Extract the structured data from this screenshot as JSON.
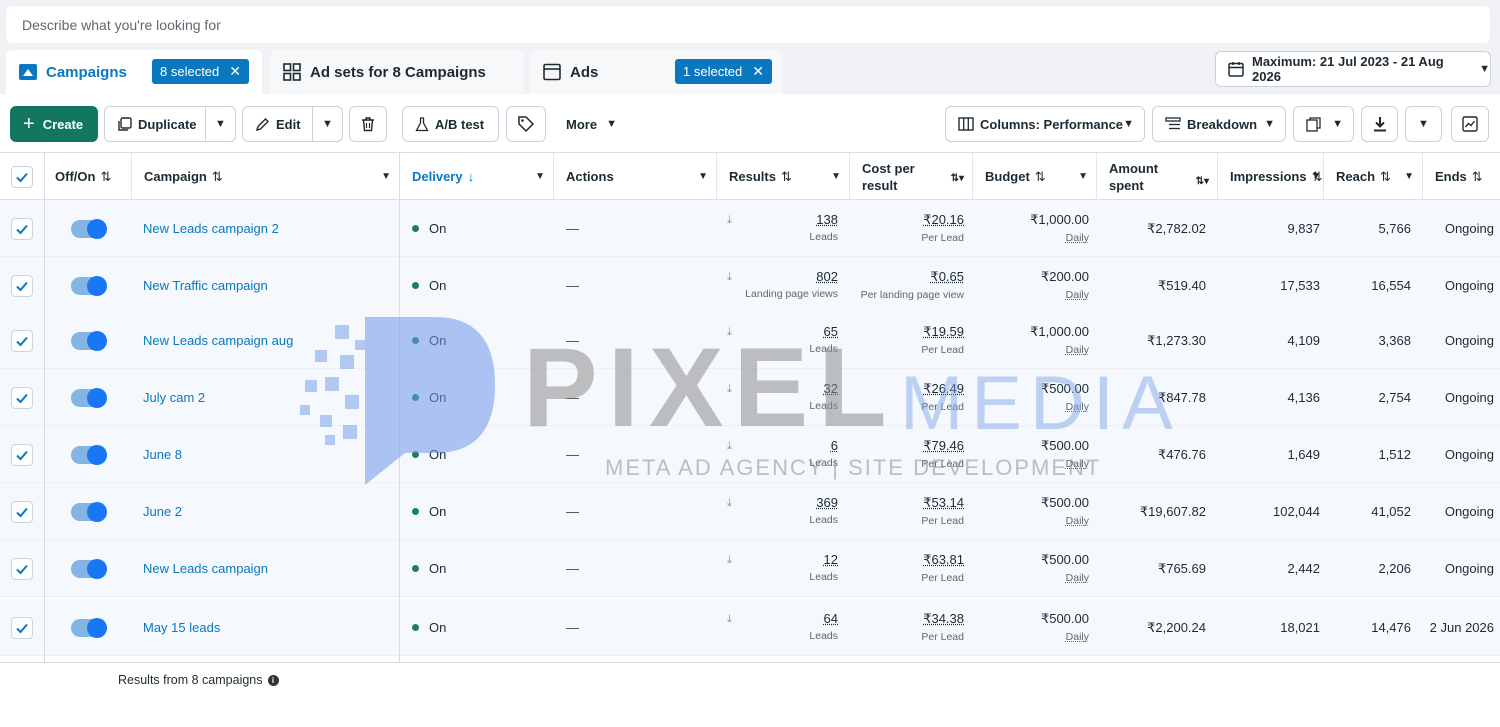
{
  "search": {
    "placeholder": "Describe what you're looking for"
  },
  "tabs": {
    "campaigns": {
      "label": "Campaigns",
      "badge": "8 selected"
    },
    "adsets": {
      "label": "Ad sets for 8 Campaigns"
    },
    "ads": {
      "label": "Ads",
      "badge": "1 selected"
    }
  },
  "date_range": "Maximum: 21 Jul 2023 - 21 Aug 2026",
  "toolbar": {
    "create": "Create",
    "duplicate": "Duplicate",
    "edit": "Edit",
    "ab_test": "A/B test",
    "more": "More",
    "columns": "Columns: Performance",
    "breakdown": "Breakdown"
  },
  "columns": {
    "offon": "Off/On",
    "campaign": "Campaign",
    "delivery": "Delivery",
    "actions": "Actions",
    "results": "Results",
    "cost_line1": "Cost per",
    "cost_line2": "result",
    "budget": "Budget",
    "amount_line1": "Amount",
    "amount_line2": "spent",
    "impressions": "Impressions",
    "reach": "Reach",
    "ends": "Ends"
  },
  "rows": [
    {
      "name": "New Leads campaign 2",
      "delivery": "On",
      "actions": "—",
      "results": "138",
      "results_sub": "Leads",
      "cost": "₹20.16",
      "cost_sub": "Per Lead",
      "budget": "₹1,000.00",
      "budget_sub": "Daily",
      "spent": "₹2,782.02",
      "impressions": "9,837",
      "reach": "5,766",
      "ends": "Ongoing"
    },
    {
      "name": "New Traffic campaign",
      "delivery": "On",
      "actions": "—",
      "results": "802",
      "results_sub": "Landing page views",
      "cost": "₹0.65",
      "cost_sub": "Per landing page view",
      "budget": "₹200.00",
      "budget_sub": "Daily",
      "spent": "₹519.40",
      "impressions": "17,533",
      "reach": "16,554",
      "ends": "Ongoing"
    },
    {
      "name": "New Leads campaign aug",
      "delivery": "On",
      "actions": "—",
      "results": "65",
      "results_sub": "Leads",
      "cost": "₹19.59",
      "cost_sub": "Per Lead",
      "budget": "₹1,000.00",
      "budget_sub": "Daily",
      "spent": "₹1,273.30",
      "impressions": "4,109",
      "reach": "3,368",
      "ends": "Ongoing"
    },
    {
      "name": "July cam 2",
      "delivery": "On",
      "actions": "—",
      "results": "32",
      "results_sub": "Leads",
      "cost": "₹26.49",
      "cost_sub": "Per Lead",
      "budget": "₹500.00",
      "budget_sub": "Daily",
      "spent": "₹847.78",
      "impressions": "4,136",
      "reach": "2,754",
      "ends": "Ongoing"
    },
    {
      "name": "June 8",
      "delivery": "On",
      "actions": "—",
      "results": "6",
      "results_sub": "Leads",
      "cost": "₹79.46",
      "cost_sub": "Per Lead",
      "budget": "₹500.00",
      "budget_sub": "Daily",
      "spent": "₹476.76",
      "impressions": "1,649",
      "reach": "1,512",
      "ends": "Ongoing"
    },
    {
      "name": "June 2",
      "delivery": "On",
      "actions": "—",
      "results": "369",
      "results_sub": "Leads",
      "cost": "₹53.14",
      "cost_sub": "Per Lead",
      "budget": "₹500.00",
      "budget_sub": "Daily",
      "spent": "₹19,607.82",
      "impressions": "102,044",
      "reach": "41,052",
      "ends": "Ongoing"
    },
    {
      "name": "New Leads campaign",
      "delivery": "On",
      "actions": "—",
      "results": "12",
      "results_sub": "Leads",
      "cost": "₹63.81",
      "cost_sub": "Per Lead",
      "budget": "₹500.00",
      "budget_sub": "Daily",
      "spent": "₹765.69",
      "impressions": "2,442",
      "reach": "2,206",
      "ends": "Ongoing"
    },
    {
      "name": "May 15 leads",
      "delivery": "On",
      "actions": "—",
      "results": "64",
      "results_sub": "Leads",
      "cost": "₹34.38",
      "cost_sub": "Per Lead",
      "budget": "₹500.00",
      "budget_sub": "Daily",
      "spent": "₹2,200.24",
      "impressions": "18,021",
      "reach": "14,476",
      "ends": "2 Jun 2026"
    }
  ],
  "footer": {
    "text": "Results from 8 campaigns"
  },
  "watermark": {
    "brand": "PIXEL",
    "brand2": "MEDIA",
    "tagline": "META AD AGENCY  |  SITE DEVELOPMENT"
  },
  "colors": {
    "accent": "#0a78be",
    "create": "#13765f",
    "toggle": "#1877f2",
    "status_on": "#1a7f5a"
  }
}
